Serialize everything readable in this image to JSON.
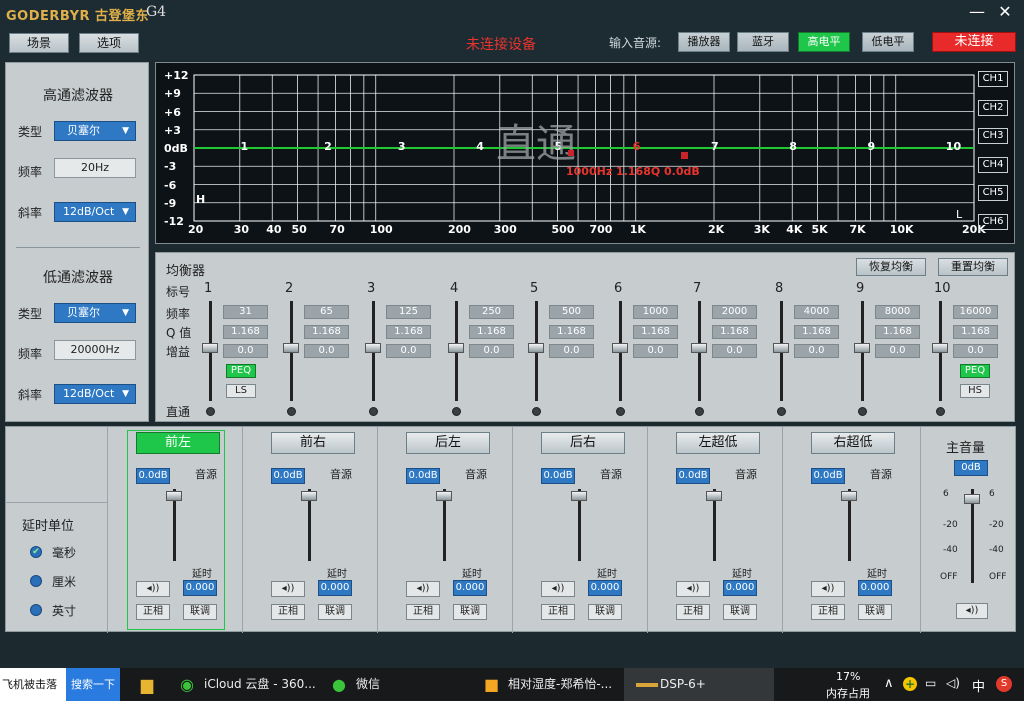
{
  "titlebar": {
    "logo": "GODERBYR 古登堡东",
    "model": "G4",
    "min": "—",
    "close": "✕"
  },
  "toolbar": {
    "scene": "场景",
    "options": "选项",
    "status": "未连接设备",
    "input_label": "输入音源:",
    "sources": [
      "播放器",
      "蓝牙",
      "高电平",
      "低电平"
    ],
    "connect": "未连接",
    "colors": {
      "status": "#e8342d",
      "active_source": "#1ec64a",
      "connect_bg": "#e82a2a"
    }
  },
  "highpass": {
    "title": "高通滤波器",
    "type_label": "类型",
    "type_value": "贝塞尔",
    "freq_label": "频率",
    "freq_value": "20Hz",
    "slope_label": "斜率",
    "slope_value": "12dB/Oct"
  },
  "lowpass": {
    "title": "低通滤波器",
    "type_label": "类型",
    "type_value": "贝塞尔",
    "freq_label": "频率",
    "freq_value": "20000Hz",
    "slope_label": "斜率",
    "slope_value": "12dB/Oct"
  },
  "graph": {
    "db_labels": [
      "+12",
      "+9",
      "+6",
      "+3",
      "0dB",
      "-3",
      "-6",
      "-9",
      "-12"
    ],
    "freq_labels": [
      "20",
      "30",
      "40",
      "50",
      "70",
      "100",
      "200",
      "300",
      "500",
      "700",
      "1K",
      "2K",
      "3K",
      "4K",
      "5K",
      "7K",
      "10K",
      "20K"
    ],
    "band_marks": [
      "1",
      "2",
      "3",
      "4",
      "5",
      "6",
      "7",
      "8",
      "9",
      "10"
    ],
    "watermark": "直通",
    "readout": "1000Hz 1.168Q 0.0dB",
    "hp_mark": "H",
    "lp_mark": "L",
    "channels": [
      "CH1",
      "CH2",
      "CH3",
      "CH4",
      "CH5",
      "CH6"
    ]
  },
  "eq": {
    "title": "均衡器",
    "restore": "恢复均衡",
    "reset": "重置均衡",
    "row_labels": {
      "index": "标号",
      "freq": "频率",
      "q": "Q 值",
      "gain": "增益",
      "bypass": "直通"
    },
    "bands": [
      {
        "n": "1",
        "freq": "31",
        "q": "1.168",
        "gain": "0.0"
      },
      {
        "n": "2",
        "freq": "65",
        "q": "1.168",
        "gain": "0.0"
      },
      {
        "n": "3",
        "freq": "125",
        "q": "1.168",
        "gain": "0.0"
      },
      {
        "n": "4",
        "freq": "250",
        "q": "1.168",
        "gain": "0.0"
      },
      {
        "n": "5",
        "freq": "500",
        "q": "1.168",
        "gain": "0.0"
      },
      {
        "n": "6",
        "freq": "1000",
        "q": "1.168",
        "gain": "0.0"
      },
      {
        "n": "7",
        "freq": "2000",
        "q": "1.168",
        "gain": "0.0"
      },
      {
        "n": "8",
        "freq": "4000",
        "q": "1.168",
        "gain": "0.0"
      },
      {
        "n": "9",
        "freq": "8000",
        "q": "1.168",
        "gain": "0.0"
      },
      {
        "n": "10",
        "freq": "16000",
        "q": "1.168",
        "gain": "0.0"
      }
    ],
    "peq": "PEQ",
    "ls": "LS",
    "hs": "HS"
  },
  "delay": {
    "title": "延时单位",
    "options": [
      "毫秒",
      "厘米",
      "英寸"
    ]
  },
  "channels": [
    {
      "name": "前左",
      "db": "0.0dB",
      "src": "音源",
      "delay_label": "延时",
      "delay": "0.000",
      "phase": "正相",
      "link": "联调"
    },
    {
      "name": "前右",
      "db": "0.0dB",
      "src": "音源",
      "delay_label": "延时",
      "delay": "0.000",
      "phase": "正相",
      "link": "联调"
    },
    {
      "name": "后左",
      "db": "0.0dB",
      "src": "音源",
      "delay_label": "延时",
      "delay": "0.000",
      "phase": "正相",
      "link": "联调"
    },
    {
      "name": "后右",
      "db": "0.0dB",
      "src": "音源",
      "delay_label": "延时",
      "delay": "0.000",
      "phase": "正相",
      "link": "联调"
    },
    {
      "name": "左超低",
      "db": "0.0dB",
      "src": "音源",
      "delay_label": "延时",
      "delay": "0.000",
      "phase": "正相",
      "link": "联调"
    },
    {
      "name": "右超低",
      "db": "0.0dB",
      "src": "音源",
      "delay_label": "延时",
      "delay": "0.000",
      "phase": "正相",
      "link": "联调"
    }
  ],
  "master": {
    "title": "主音量",
    "value": "0dB",
    "scale": [
      "6",
      "-20",
      "-40",
      "OFF"
    ]
  },
  "taskbar": {
    "news": "飞机被击落",
    "search": "搜索一下",
    "icloud": "iCloud 云盘 - 360...",
    "wechat": "微信",
    "doc": "相对湿度-郑希怡-...",
    "dsp": "DSP-6+",
    "mem_pct": "17%",
    "mem_label": "内存占用",
    "ime": "中"
  }
}
